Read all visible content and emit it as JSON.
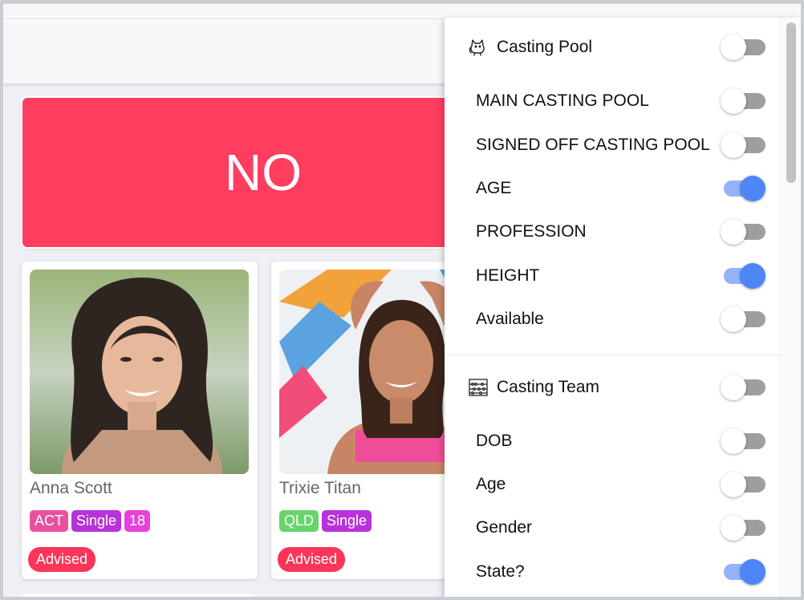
{
  "banner": {
    "text": "NO"
  },
  "cards": [
    {
      "name": "Anna Scott",
      "tags": [
        {
          "label": "ACT",
          "color": "#e9519e"
        },
        {
          "label": "Single",
          "color": "#b832da"
        },
        {
          "label": "18",
          "color": "#e642d8"
        }
      ],
      "status": "Advised"
    },
    {
      "name": "Trixie Titan",
      "tags": [
        {
          "label": "QLD",
          "color": "#69d46b"
        },
        {
          "label": "Single",
          "color": "#b832da"
        }
      ],
      "status": "Advised"
    }
  ],
  "panel": {
    "casting_pool": {
      "title": "Casting Pool",
      "icon": "cat-icon",
      "enabled": false,
      "items": [
        {
          "label": "MAIN CASTING POOL",
          "enabled": false
        },
        {
          "label": "SIGNED OFF CASTING POOL",
          "enabled": false
        },
        {
          "label": "AGE",
          "enabled": true
        },
        {
          "label": "PROFESSION",
          "enabled": false
        },
        {
          "label": "HEIGHT",
          "enabled": true
        },
        {
          "label": "Available",
          "enabled": false
        }
      ]
    },
    "casting_team": {
      "title": "Casting Team",
      "icon": "abacus-icon",
      "enabled": false,
      "items": [
        {
          "label": "DOB",
          "enabled": false
        },
        {
          "label": "Age",
          "enabled": false
        },
        {
          "label": "Gender",
          "enabled": false
        },
        {
          "label": "State?",
          "enabled": true
        }
      ]
    }
  },
  "colors": {
    "banner": "#fe3d5f",
    "advised": "#f9365a",
    "toggle_on": "#4f86f7",
    "toggle_off": "#9e9e9e"
  }
}
